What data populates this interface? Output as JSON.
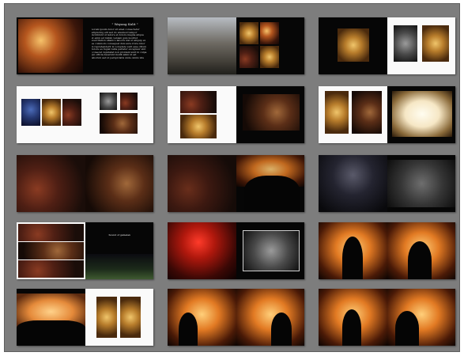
{
  "album": {
    "spread_count": 15,
    "layout": "grid-3-columns-5-rows"
  },
  "spreads": [
    {
      "id": 1,
      "heading": "\" Wayang Kulit \"",
      "body": "Lorem ipsum dolor sit amet consectetur adipiscing elit sed do eiusmod tempor incididunt ut labore et dolore magna aliqua ut enim ad minim veniam quis nostrud exercitation ullamco laboris nisi ut aliquip ex ea commodo consequat duis aute irure dolor in reprehenderit in voluptate velit esse cillum dolore eu fugiat nulla pariatur excepteur sint occaecat cupidatat non proident sunt in culpa qui officia deserunt mollit anim id est laborum sed ut perspiciatis unde omnis iste natus error sit voluptatem accusantium doloremque laudantium totam rem aperiam eaque ipsa quae ab illo inventore veritatis"
    },
    {
      "id": 2
    },
    {
      "id": 3
    },
    {
      "id": 4
    },
    {
      "id": 5
    },
    {
      "id": 6
    },
    {
      "id": 7
    },
    {
      "id": 8
    },
    {
      "id": 9
    },
    {
      "id": 10,
      "heading": "Sound of gamelan"
    },
    {
      "id": 11
    },
    {
      "id": 12
    },
    {
      "id": 13
    },
    {
      "id": 14
    },
    {
      "id": 15
    }
  ],
  "colors": {
    "background": "#7d7d7d",
    "page_dark": "#060606",
    "page_white": "#fafafa"
  }
}
